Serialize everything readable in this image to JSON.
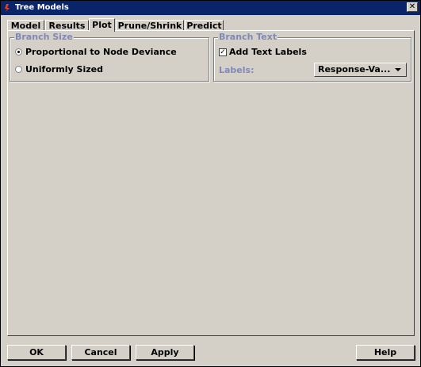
{
  "window": {
    "title": "Tree Models"
  },
  "tabs": [
    {
      "label": "Model"
    },
    {
      "label": "Results"
    },
    {
      "label": "Plot"
    },
    {
      "label": "Prune/Shrink"
    },
    {
      "label": "Predict"
    }
  ],
  "active_tab": "Plot",
  "branch_size": {
    "title": "Branch Size",
    "options": [
      {
        "label": "Proportional to Node Deviance",
        "selected": true
      },
      {
        "label": "Uniformly Sized",
        "selected": false
      }
    ]
  },
  "branch_text": {
    "title": "Branch Text",
    "add_text_labels": {
      "label": "Add Text Labels",
      "checked": true
    },
    "labels_field": {
      "label": "Labels:",
      "value": "Response-Va..."
    }
  },
  "buttons": {
    "ok": "OK",
    "cancel": "Cancel",
    "apply": "Apply",
    "help": "Help"
  },
  "icons": {
    "close": "close-icon",
    "app": "java-cup-icon",
    "dropdown": "chevron-down-icon"
  },
  "colors": {
    "titlebar": "#0a246a",
    "group_title": "#8088b8",
    "face": "#d4d0c8"
  }
}
